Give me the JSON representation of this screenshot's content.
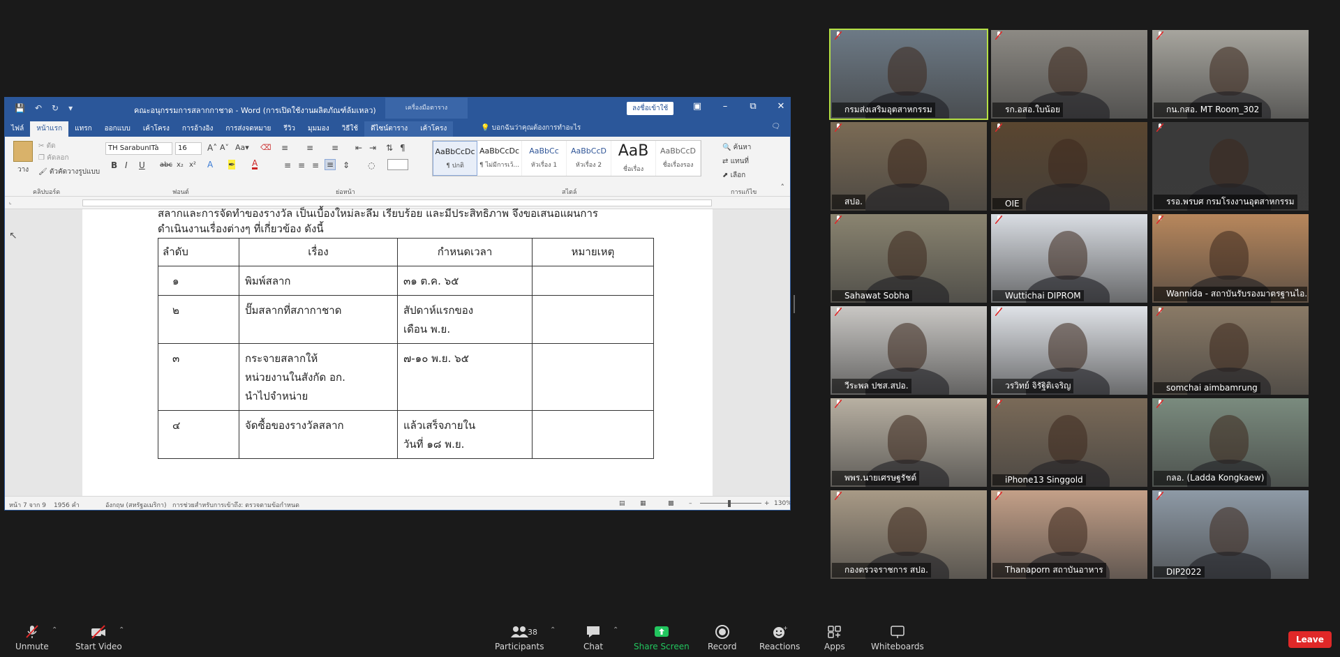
{
  "word": {
    "doc_title": "คณะอนุกรรมการสลากกาชาด - Word (การเปิดใช้งานผลิตภัณฑ์ล้มเหลว)",
    "context_tab_group": "เครื่องมือตาราง",
    "sign_in": "ลงชื่อเข้าใช้",
    "tabs": [
      "ไฟล์",
      "หน้าแรก",
      "แทรก",
      "ออกแบบ",
      "เค้าโครง",
      "การอ้างอิง",
      "การส่งจดหมาย",
      "รีวิว",
      "มุมมอง",
      "วิธีใช้",
      "ดีไซน์ตาราง",
      "เค้าโครง"
    ],
    "tell_me": "บอกฉันว่าคุณต้องการทำอะไร",
    "ribbon": {
      "paste": "วาง",
      "cut": "ตัด",
      "copy": "คัดลอก",
      "format_painter": "ตัวคัดวางรูปแบบ",
      "clipboard": "คลิปบอร์ด",
      "font_name": "TH SarabunITà",
      "font_size": "16",
      "font": "ฟอนต์",
      "paragraph": "ย่อหน้า",
      "styles_label": "สไตล์",
      "editing_label": "การแก้ไข",
      "find": "ค้นหา",
      "replace": "แทนที่",
      "select": "เลือก",
      "styles": [
        {
          "sample": "AaBbCcDc",
          "name": "¶ ปกติ"
        },
        {
          "sample": "AaBbCcDc",
          "name": "¶ ไม่มีการเว้..."
        },
        {
          "sample": "AaBbCc",
          "name": "หัวเรื่อง 1"
        },
        {
          "sample": "AaBbCcD",
          "name": "หัวเรื่อง 2"
        },
        {
          "sample": "AaB",
          "name": "ชื่อเรื่อง"
        },
        {
          "sample": "AaBbCcD",
          "name": "ชื่อเรื่องรอง"
        }
      ]
    },
    "page_text_line1": "สลากและการจัดทำของรางวัล เป็นเบื้องใหม่ละลึม เรียบร้อย และมีประสิทธิภาพ จึงขอเสนอแผนการ",
    "page_text_line2": "ดำเนินงานเรื่องต่างๆ ที่เกี่ยวข้อง ดังนี้",
    "table": {
      "headers": [
        "ลำดับ",
        "เรื่อง",
        "กำหนดเวลา",
        "หมายเหตุ"
      ],
      "rows": [
        [
          "๑",
          "พิมพ์สลาก",
          "๓๑ ต.ค. ๖๕",
          ""
        ],
        [
          "๒",
          "ปั๊มสลากที่สภากาชาด",
          "สัปดาห์แรกของ\nเดือน พ.ย.",
          ""
        ],
        [
          "๓",
          "กระจายสลากให้\nหน่วยงานในสังกัด อก.\nนำไปจำหน่าย",
          "๗-๑๐ พ.ย. ๖๕",
          ""
        ],
        [
          "๔",
          "จัดซื้อของรางวัลสลาก",
          "แล้วเสร็จภายใน\nวันที่ ๑๘ พ.ย.",
          ""
        ]
      ]
    },
    "status": {
      "page": "หน้า 7 จาก 9",
      "words": "1956 คำ",
      "language": "อังกฤษ (สหรัฐอเมริกา)",
      "accessibility": "การช่วยสำหรับการเข้าถึง: ตรวจตามข้อกำหนด",
      "zoom": "130%"
    }
  },
  "participants": [
    {
      "name": "กรมส่งเสริมอุตสาหกรรม",
      "bg": "#6d7a86"
    },
    {
      "name": "รก.อสอ.ใบน้อย",
      "bg": "#8d8a84"
    },
    {
      "name": "กน.กสอ. MT Room_302",
      "bg": "#a7a59e"
    },
    {
      "name": "สปอ.",
      "bg": "#7b6b55"
    },
    {
      "name": "OIE",
      "bg": "#5a4630"
    },
    {
      "name": "รรอ.พรบศ กรมโรงงานอุตสาหกรรม",
      "bg": "#3a3a3a"
    },
    {
      "name": "Sahawat Sobha",
      "bg": "#8a8470"
    },
    {
      "name": "Wuttichai DIPROM",
      "bg": "#d9dde3"
    },
    {
      "name": "Wannida - สถาบันรับรองมาตรฐานไอ...",
      "bg": "#b8875c"
    },
    {
      "name": "วีระพล ปชส.สปอ.",
      "bg": "#c9c7c4"
    },
    {
      "name": "วรวิทย์ จิรัฐิติเจริญ",
      "bg": "#dfe2e7"
    },
    {
      "name": "somchai aimbamrung",
      "bg": "#8a7a66"
    },
    {
      "name": "พพร.นายเศรษฐรัชต์",
      "bg": "#b8b0a2"
    },
    {
      "name": "iPhone13 Singgold",
      "bg": "#7a6a58"
    },
    {
      "name": "กลอ. (Ladda Kongkaew)",
      "bg": "#7a8b7e"
    },
    {
      "name": "กองตรวจราชการ สปอ.",
      "bg": "#a89a86"
    },
    {
      "name": "Thanaporn สถาบันอาหาร",
      "bg": "#c4a088"
    },
    {
      "name": "DIP2022",
      "bg": "#8e9aa6"
    }
  ],
  "toolbar": {
    "unmute": "Unmute",
    "start_video": "Start Video",
    "participants": "Participants",
    "participants_count": "38",
    "chat": "Chat",
    "share": "Share Screen",
    "record": "Record",
    "reactions": "Reactions",
    "apps": "Apps",
    "whiteboards": "Whiteboards",
    "leave": "Leave"
  }
}
